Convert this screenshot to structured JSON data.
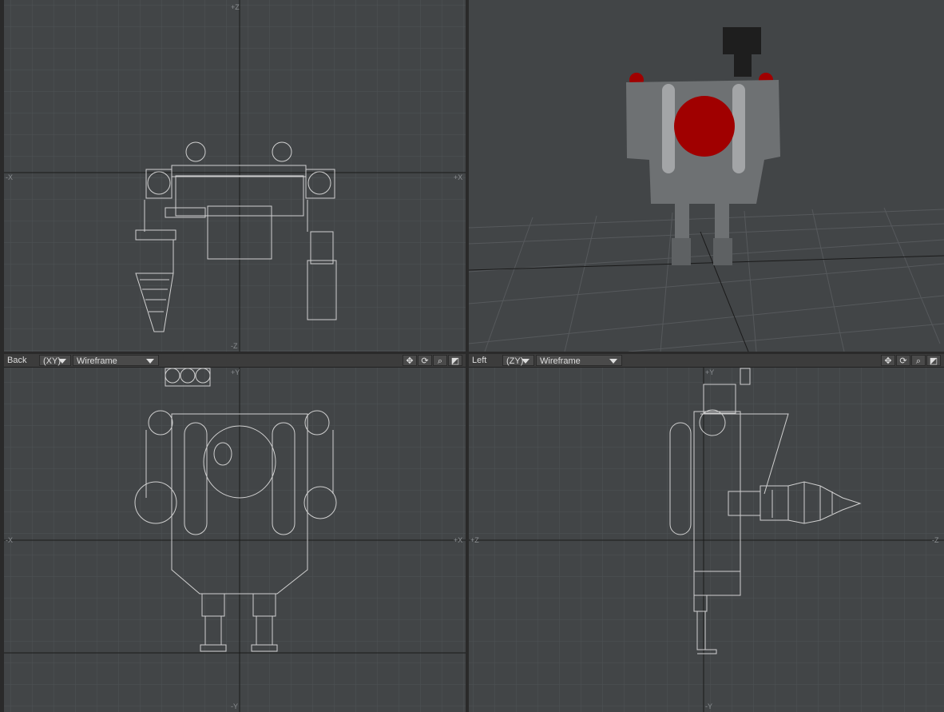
{
  "viewports": {
    "top": {
      "axis_top": "+Z",
      "axis_left": "-X",
      "axis_right": "+X",
      "axis_bottom": "-Z"
    },
    "back": {
      "view_label": "Back",
      "axes_label": "(XY)",
      "mode_label": "Wireframe",
      "axis_top": "+Y",
      "axis_left": "-X",
      "axis_right": "+X",
      "axis_bottom": "-Y"
    },
    "left": {
      "view_label": "Left",
      "axes_label": "(ZY)",
      "mode_label": "Wireframe",
      "axis_top": "+Y",
      "axis_left": "+Z",
      "axis_right": "-Z",
      "axis_bottom": "-Y"
    }
  },
  "icons": {
    "move": "move-icon",
    "rotate": "rotate-icon",
    "zoom": "zoom-icon",
    "maximize": "maximize-icon"
  },
  "colors": {
    "viewport_bg": "#424547",
    "grid": "#4e5255",
    "axis": "#1a1a1a",
    "wire": "#d0d0d0",
    "model_body": "#6e7173",
    "model_red": "#a00000",
    "model_black": "#1e1e1e"
  }
}
